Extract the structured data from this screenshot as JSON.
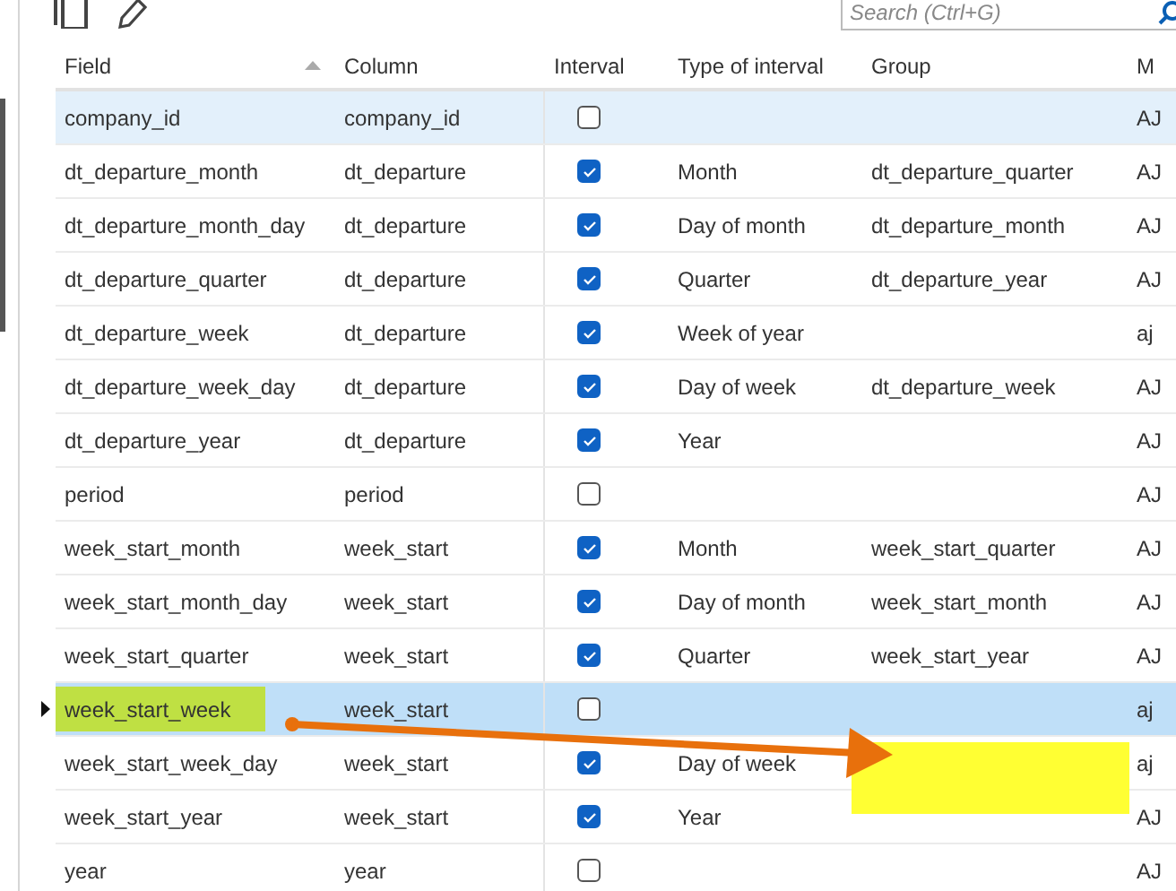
{
  "search": {
    "placeholder": "Search (Ctrl+G)"
  },
  "table": {
    "columns": [
      {
        "label": "Field",
        "sorted": true
      },
      {
        "label": "Column",
        "sorted": false
      },
      {
        "label": "Interval",
        "sorted": false
      },
      {
        "label": "Type of interval",
        "sorted": false
      },
      {
        "label": "Group",
        "sorted": false
      },
      {
        "label": "M",
        "sorted": false
      }
    ],
    "rows": [
      {
        "field": "company_id",
        "column": "company_id",
        "interval": false,
        "type": "",
        "group": "",
        "column_6": "AJ",
        "selected": false,
        "hovered": true,
        "marked": false
      },
      {
        "field": "dt_departure_month",
        "column": "dt_departure",
        "interval": true,
        "type": "Month",
        "group": "dt_departure_quarter",
        "column_6": "AJ",
        "selected": false,
        "hovered": false,
        "marked": false
      },
      {
        "field": "dt_departure_month_day",
        "column": "dt_departure",
        "interval": true,
        "type": "Day of month",
        "group": "dt_departure_month",
        "column_6": "AJ",
        "selected": false,
        "hovered": false,
        "marked": false
      },
      {
        "field": "dt_departure_quarter",
        "column": "dt_departure",
        "interval": true,
        "type": "Quarter",
        "group": "dt_departure_year",
        "column_6": "AJ",
        "selected": false,
        "hovered": false,
        "marked": false
      },
      {
        "field": "dt_departure_week",
        "column": "dt_departure",
        "interval": true,
        "type": "Week of year",
        "group": "",
        "column_6": "aj",
        "selected": false,
        "hovered": false,
        "marked": false
      },
      {
        "field": "dt_departure_week_day",
        "column": "dt_departure",
        "interval": true,
        "type": "Day of week",
        "group": "dt_departure_week",
        "column_6": "AJ",
        "selected": false,
        "hovered": false,
        "marked": false
      },
      {
        "field": "dt_departure_year",
        "column": "dt_departure",
        "interval": true,
        "type": "Year",
        "group": "",
        "column_6": "AJ",
        "selected": false,
        "hovered": false,
        "marked": false
      },
      {
        "field": "period",
        "column": "period",
        "interval": false,
        "type": "",
        "group": "",
        "column_6": "AJ",
        "selected": false,
        "hovered": false,
        "marked": false
      },
      {
        "field": "week_start_month",
        "column": "week_start",
        "interval": true,
        "type": "Month",
        "group": "week_start_quarter",
        "column_6": "AJ",
        "selected": false,
        "hovered": false,
        "marked": false
      },
      {
        "field": "week_start_month_day",
        "column": "week_start",
        "interval": true,
        "type": "Day of month",
        "group": "week_start_month",
        "column_6": "AJ",
        "selected": false,
        "hovered": false,
        "marked": false
      },
      {
        "field": "week_start_quarter",
        "column": "week_start",
        "interval": true,
        "type": "Quarter",
        "group": "week_start_year",
        "column_6": "AJ",
        "selected": false,
        "hovered": false,
        "marked": false
      },
      {
        "field": "week_start_week",
        "column": "week_start",
        "interval": false,
        "type": "",
        "group": "",
        "column_6": "aj",
        "selected": true,
        "hovered": false,
        "marked": true
      },
      {
        "field": "week_start_week_day",
        "column": "week_start",
        "interval": true,
        "type": "Day of week",
        "group": "",
        "column_6": "aj",
        "selected": false,
        "hovered": false,
        "marked": false
      },
      {
        "field": "week_start_year",
        "column": "week_start",
        "interval": true,
        "type": "Year",
        "group": "",
        "column_6": "AJ",
        "selected": false,
        "hovered": false,
        "marked": false
      },
      {
        "field": "year",
        "column": "year",
        "interval": false,
        "type": "",
        "group": "",
        "column_6": "AJ",
        "selected": false,
        "hovered": false,
        "marked": false
      }
    ]
  }
}
